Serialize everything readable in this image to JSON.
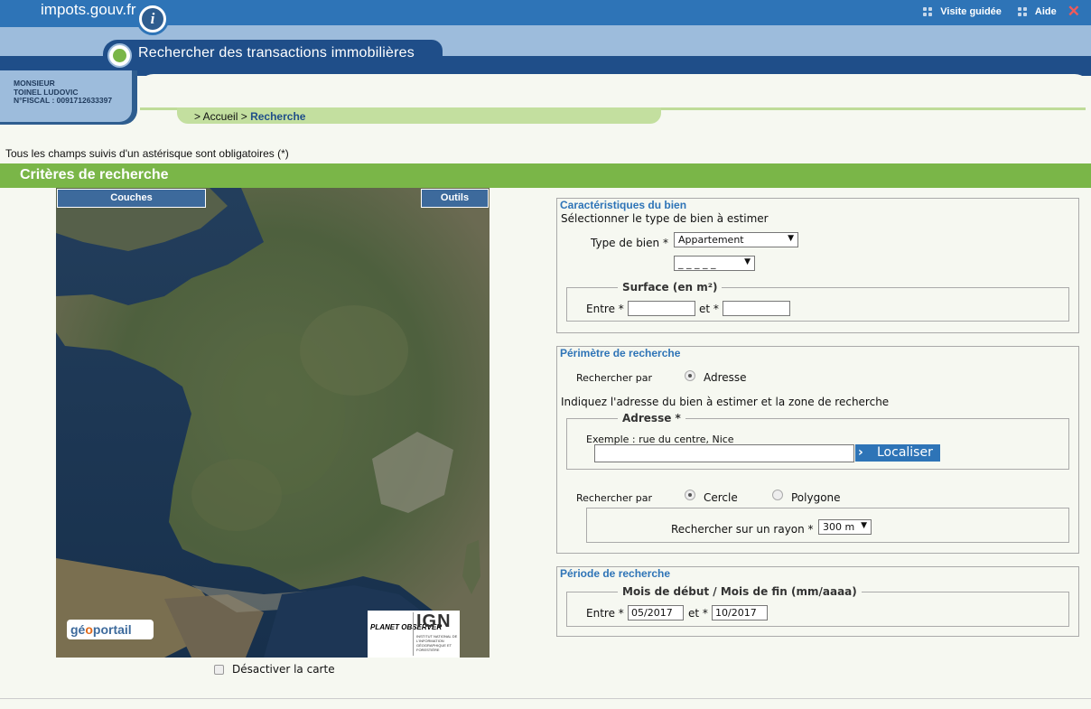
{
  "header": {
    "logo": "impots.gouv.fr",
    "logo_icon": "i",
    "links": [
      "Visite guidée",
      "Aide"
    ],
    "close": "✕",
    "title": "Rechercher des transactions immobilières"
  },
  "user": {
    "civility": "MONSIEUR",
    "name": "TOINEL LUDOVIC",
    "fiscal": "N°FISCAL : 0091712633397"
  },
  "breadcrumb": {
    "home": "> Accueil",
    "sep": ">",
    "current": "Recherche"
  },
  "mandatory_note": "Tous les champs suivis d'un astérisque sont obligatoires (*)",
  "criteria_title": "Critères de recherche",
  "map": {
    "layers_btn": "Couches",
    "tools_btn": "Outils",
    "geoportail": {
      "pre": "gé",
      "o": "o",
      "post": "portail"
    },
    "planet_observer": "PLANET OBSERVER",
    "ign": "IGN",
    "ign_sub": "INSTITUT NATIONAL DE L'INFORMATION GÉOGRAPHIQUE ET FORESTIÈRE",
    "disable_label": "Désactiver la carte"
  },
  "caracteristiques": {
    "legend": "Caractéristiques du bien",
    "intro": "Sélectionner le type de bien à estimer",
    "type_label": "Type de bien *",
    "type_value": "Appartement",
    "sub_value": "_ _ _ _ _",
    "surface_legend": "Surface (en m²)",
    "entre": "Entre *",
    "et": "et *",
    "surface_min": "",
    "surface_max": ""
  },
  "perimetre": {
    "legend": "Périmètre de recherche",
    "search_by": "Rechercher par",
    "adresse_opt": "Adresse",
    "intro": "Indiquez l'adresse du bien à estimer et la zone de recherche",
    "adresse_legend": "Adresse *",
    "example": "Exemple : rue du centre, Nice",
    "adresse_value": "",
    "localiser": "Localiser",
    "search_by2": "Rechercher par",
    "cercle": "Cercle",
    "polygone": "Polygone",
    "rayon_label": "Rechercher sur un rayon *",
    "rayon_value": "300 m"
  },
  "periode": {
    "legend": "Période de recherche",
    "sub_legend": "Mois de début / Mois de fin (mm/aaaa)",
    "entre": "Entre *",
    "et": "et *",
    "start": "05/2017",
    "end": "10/2017"
  }
}
